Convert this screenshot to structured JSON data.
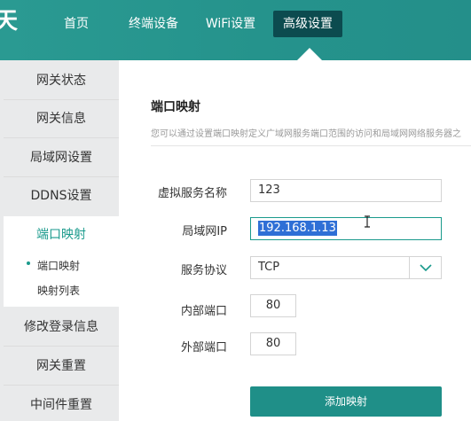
{
  "header": {
    "logo_text": "天",
    "nav": [
      "首页",
      "终端设备",
      "WiFi设置",
      "高级设置"
    ],
    "active_nav": "高级设置"
  },
  "sidebar": {
    "items": [
      "网关状态",
      "网关信息",
      "局域网设置",
      "DDNS设置",
      "端口映射",
      "修改登录信息",
      "网关重置",
      "中间件重置"
    ],
    "active": "端口映射",
    "sub_items": [
      "端口映射",
      "映射列表"
    ]
  },
  "content": {
    "title": "端口映射",
    "description": "您可以通过设置端口映射定义广域网服务端口范围的访问和局域网网络服务器之",
    "form": {
      "service_name_label": "虚拟服务名称",
      "service_name_value": "123",
      "lan_ip_label": "局域网IP",
      "lan_ip_value": "192.168.1.13",
      "protocol_label": "服务协议",
      "protocol_value": "TCP",
      "internal_port_label": "内部端口",
      "internal_port_value": "80",
      "external_port_label": "外部端口",
      "external_port_value": "80"
    },
    "submit_label": "添加映射"
  },
  "colors": {
    "header": "#25938c",
    "accent": "#1a9a8c",
    "active_nav_bg": "#0c4b4f",
    "selection": "#2f6fd6"
  }
}
